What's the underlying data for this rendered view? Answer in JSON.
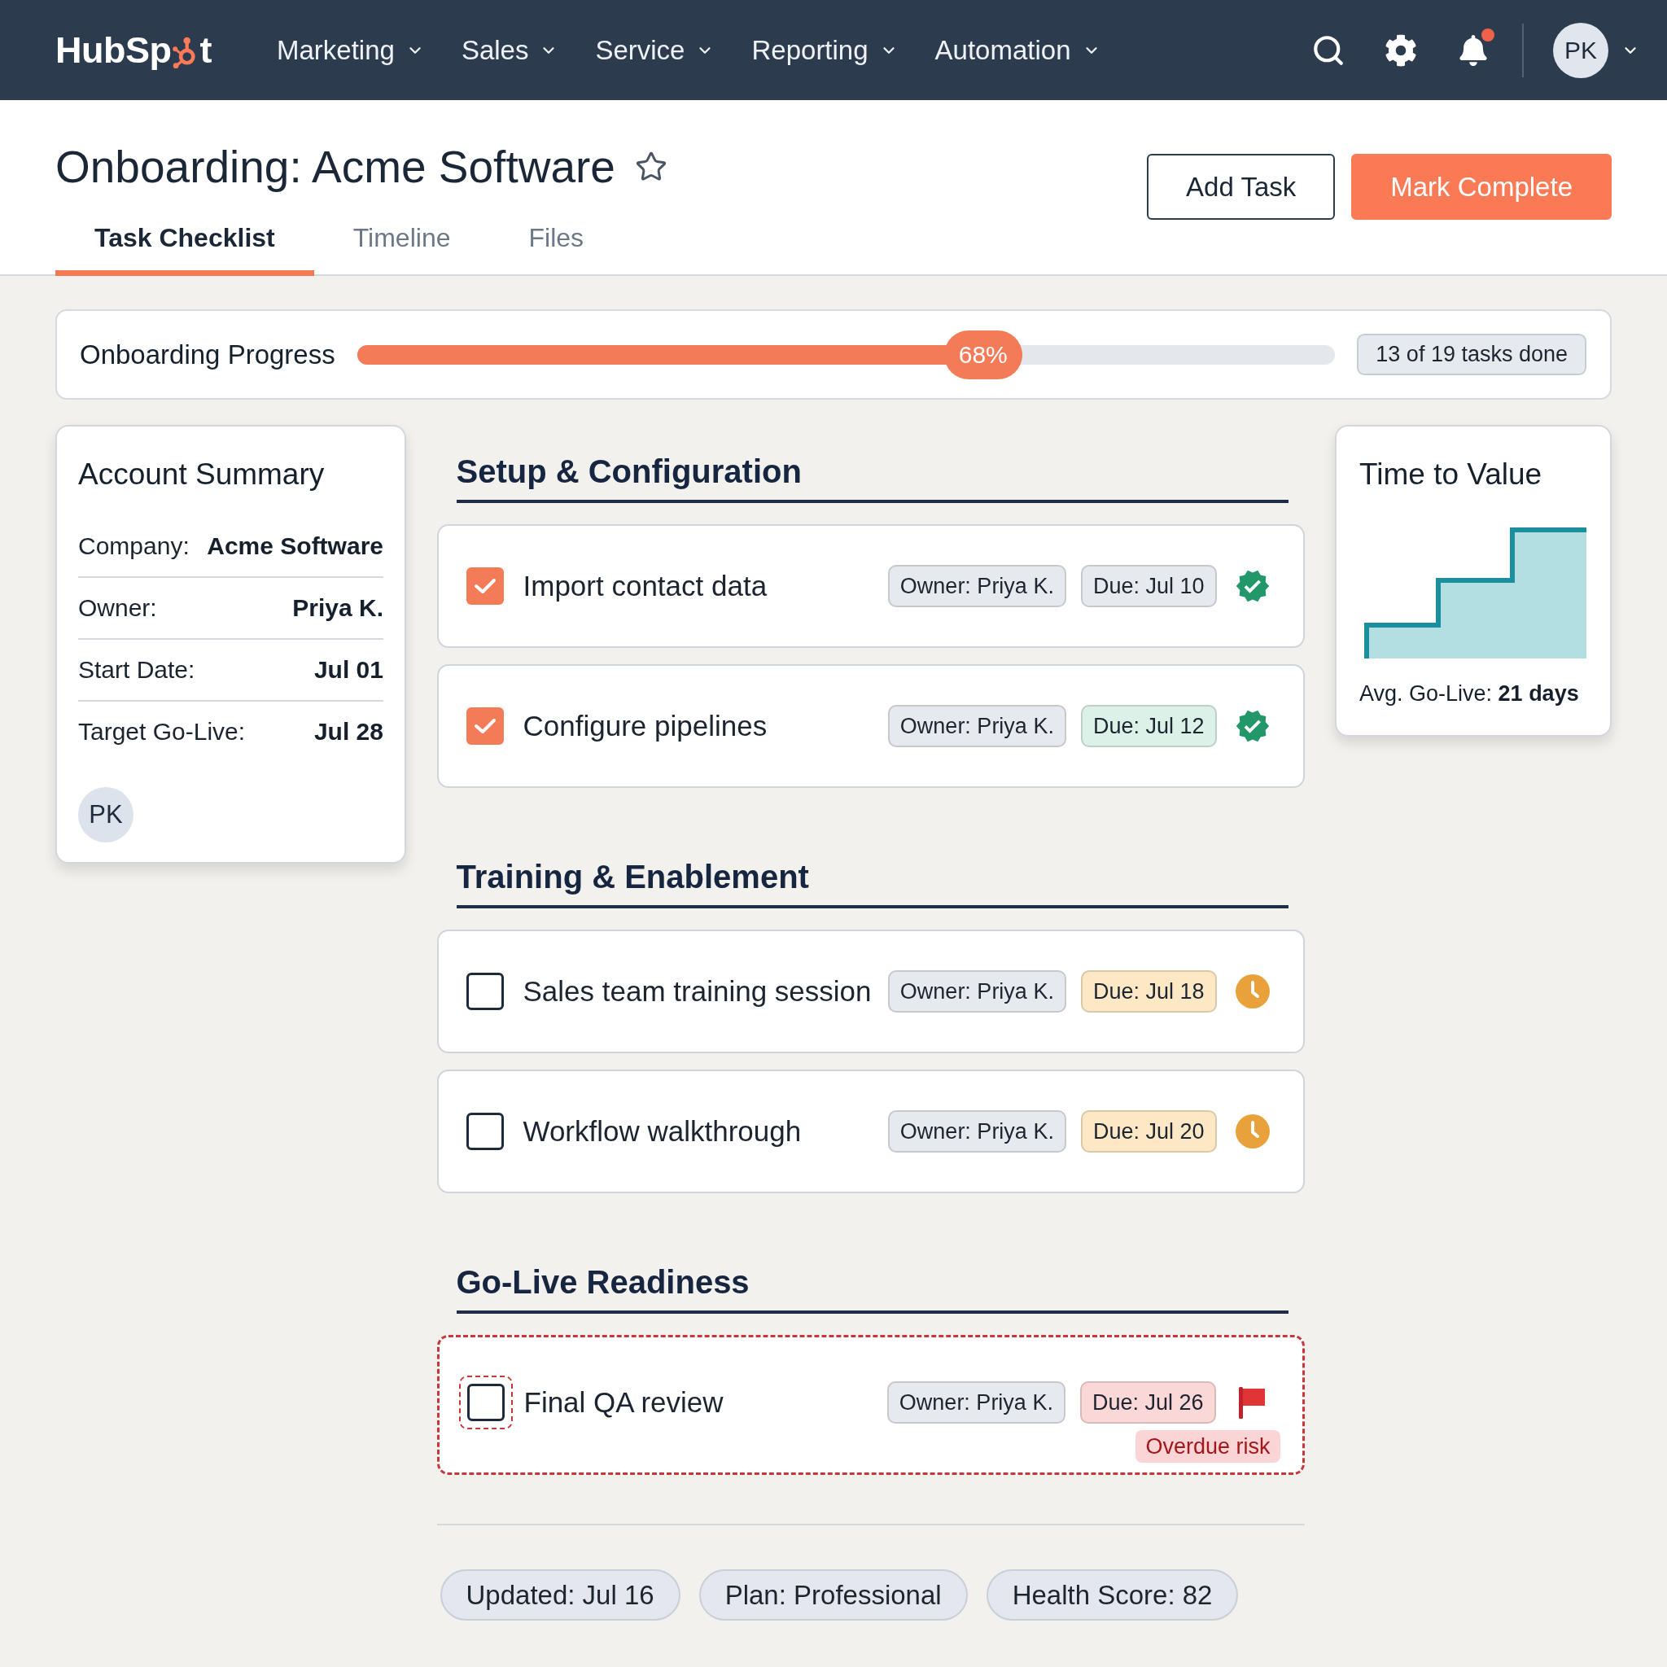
{
  "nav": {
    "logo": {
      "text_start": "HubSp",
      "text_end": "t"
    },
    "menu": [
      {
        "label": "Marketing"
      },
      {
        "label": "Sales"
      },
      {
        "label": "Service"
      },
      {
        "label": "Reporting"
      },
      {
        "label": "Automation"
      }
    ],
    "has_notifications": true,
    "avatar": "PK"
  },
  "page": {
    "title": "Onboarding: Acme Software",
    "starred": false,
    "actions": [
      {
        "label": "Add Task",
        "kind": "secondary"
      },
      {
        "label": "Mark Complete",
        "kind": "primary"
      }
    ],
    "tabs": [
      {
        "label": "Task Checklist",
        "selected": true
      },
      {
        "label": "Timeline",
        "selected": false
      },
      {
        "label": "Files",
        "selected": false
      }
    ]
  },
  "progress": {
    "label": "Onboarding Progress",
    "level": 0.68,
    "reading": "68%",
    "count": "13 of 19 tasks done"
  },
  "account_summary": {
    "title": "Account Summary",
    "fields": [
      {
        "label": "Company:",
        "value": "Acme Software"
      },
      {
        "label": "Owner:",
        "value": "Priya K."
      },
      {
        "label": "Start Date:",
        "value": "Jul 01"
      },
      {
        "label": "Target Go-Live:",
        "value": "Jul 28"
      }
    ],
    "avatar": "PK"
  },
  "sections": [
    {
      "title": "Setup & Configuration",
      "tasks": [
        {
          "kind": "done",
          "title": "Import contact data",
          "checked": true,
          "owner": "Owner: Priya K.",
          "due": {
            "text": "Due: Jul 10",
            "color": "#e6e9ee"
          }
        },
        {
          "kind": "done",
          "title": "Configure pipelines",
          "checked": true,
          "owner": "Owner: Priya K.",
          "due": {
            "text": "Due: Jul 12",
            "color": "#dcf2e8"
          }
        }
      ]
    },
    {
      "title": "Training & Enablement",
      "tasks": [
        {
          "kind": "pending",
          "title": "Sales team training session",
          "checked": false,
          "owner": "Owner: Priya K.",
          "due": {
            "text": "Due: Jul 18",
            "color": "#fde8c6"
          }
        },
        {
          "kind": "pending",
          "title": "Workflow walkthrough",
          "checked": false,
          "owner": "Owner: Priya K.",
          "due": {
            "text": "Due: Jul 20",
            "color": "#fde8c6"
          }
        }
      ]
    },
    {
      "title": "Go-Live Readiness",
      "tasks": [
        {
          "kind": "at_risk",
          "title": "Final QA review",
          "checked": false,
          "owner": "Owner: Priya K.",
          "due": {
            "text": "Due: Jul 26",
            "color": "#fbd8d8"
          },
          "risk": "Overdue risk"
        }
      ]
    }
  ],
  "time_to_value": {
    "title": "Time to Value",
    "summary": "Avg. Go-Live: **21 days**"
  },
  "footer": {
    "pills": [
      "Updated: Jul 16",
      "Plan: Professional",
      "Health Score: 82"
    ]
  }
}
